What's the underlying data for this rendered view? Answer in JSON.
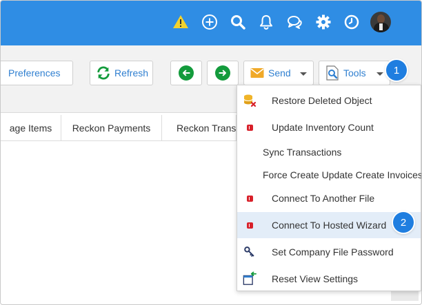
{
  "colors": {
    "topbar": "#2f8de4",
    "link": "#2f7fd0",
    "green": "#139b3c",
    "callout": "#1f7ee0",
    "highlight": "#e3edf8"
  },
  "topbar": {
    "icons": [
      "warning-icon",
      "add-circle-icon",
      "search-icon",
      "bell-icon",
      "chat-icon",
      "gear-icon",
      "clock-icon",
      "user-avatar"
    ]
  },
  "toolbar": {
    "preferences_label": "Preferences",
    "refresh_label": "Refresh",
    "send_label": "Send",
    "tools_label": "Tools"
  },
  "tabs": [
    "age Items",
    "Reckon Payments",
    "Reckon Transa"
  ],
  "menu": {
    "items": [
      {
        "label": "Restore Deleted Object",
        "icon": "database-delete-icon"
      },
      {
        "label": "Update Inventory Count",
        "icon": "reckon-icon"
      },
      {
        "label": "Sync Transactions",
        "icon": ""
      },
      {
        "label": "Force Create Update Create Invoices",
        "icon": ""
      },
      {
        "label": "Connect To Another File",
        "icon": "reckon-icon"
      },
      {
        "label": "Connect To Hosted Wizard",
        "icon": "reckon-icon"
      },
      {
        "label": "Set Company File Password",
        "icon": "key-icon"
      },
      {
        "label": "Reset View Settings",
        "icon": "window-reset-icon"
      }
    ]
  },
  "callouts": [
    "1",
    "2"
  ]
}
